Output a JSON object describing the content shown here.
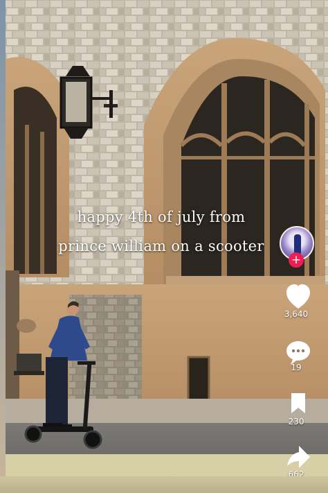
{
  "video": {
    "caption_line1": "happy 4th of july from",
    "caption_line2": "prince william on a scooter"
  },
  "actions": {
    "like_count": "3,640",
    "comment_count": "19",
    "bookmark_count": "230",
    "share_count": "662"
  },
  "profile": {
    "follow_symbol": "+"
  },
  "colors": {
    "follow_accent": "#ee1d52",
    "icon_white": "#ffffff"
  },
  "icons": {
    "like": "heart-icon",
    "comment": "comment-bubble-icon",
    "bookmark": "bookmark-icon",
    "share": "share-arrow-icon"
  }
}
